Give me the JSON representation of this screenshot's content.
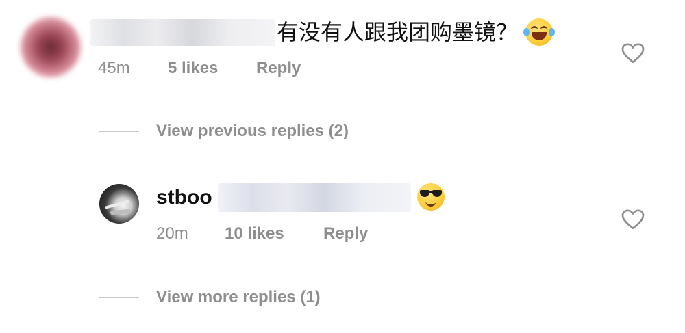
{
  "comment": {
    "text": "有没有人跟我团购墨镜？",
    "emoji_icon": "face-with-tears-of-joy-icon",
    "time": "45m",
    "likes": "5 likes",
    "reply_label": "Reply",
    "view_previous_replies": "View previous replies (2)"
  },
  "reply": {
    "username": "stboo",
    "emoji_icon": "smiling-face-with-sunglasses-icon",
    "time": "20m",
    "likes": "10 likes",
    "reply_label": "Reply",
    "view_more_replies": "View more replies (1)"
  },
  "colors": {
    "text_primary": "#111111",
    "text_secondary": "#8e8e8e",
    "divider": "#c7c7c7",
    "background": "#ffffff"
  }
}
